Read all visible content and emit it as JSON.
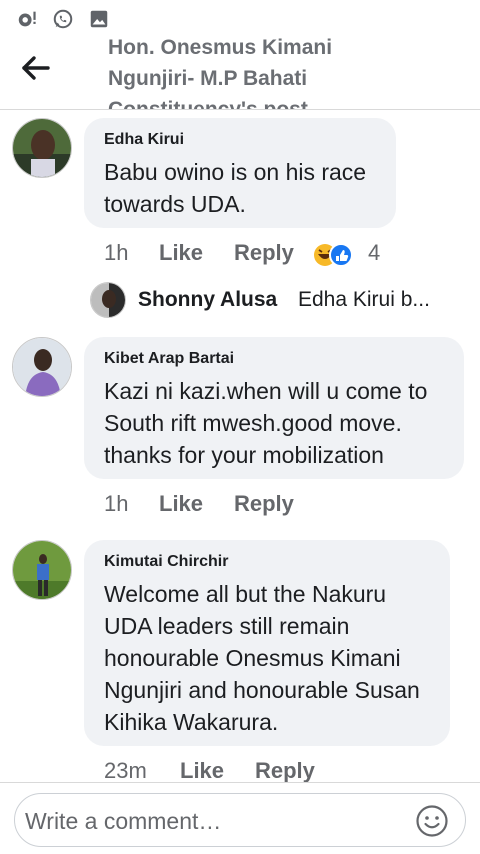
{
  "status_bar": {
    "icons": [
      "location-notification-icon",
      "whatsapp-icon",
      "gallery-icon"
    ]
  },
  "header": {
    "title_lines": [
      "Hon. Onesmus Kimani",
      "Ngunjiri- M.P Bahati",
      "Constituency's post"
    ],
    "back_icon": "arrow-left-icon"
  },
  "comments": [
    {
      "author": "Edha Kirui",
      "text_lines": [
        "Babu owino is on his race",
        "towards UDA."
      ],
      "time": "1h",
      "like_label": "Like",
      "reply_label": "Reply",
      "reaction_count": "4",
      "reply_preview": {
        "name": "Shonny Alusa",
        "snippet": "Edha Kirui b..."
      }
    },
    {
      "author": "Kibet Arap Bartai",
      "text_lines": [
        "Kazi ni kazi.when will u come to",
        "South rift mwesh.good move.",
        "thanks for your mobilization"
      ],
      "time": "1h",
      "like_label": "Like",
      "reply_label": "Reply"
    },
    {
      "author": "Kimutai Chirchir",
      "text_lines": [
        "Welcome all but the Nakuru",
        "UDA leaders still remain",
        "honourable Onesmus Kimani",
        "Ngunjiri and honourable Susan",
        "Kihika Wakarura."
      ],
      "time": "23m",
      "like_label": "Like",
      "reply_label": "Reply"
    }
  ],
  "compose": {
    "placeholder": "Write a comment…",
    "emoji_icon": "smiley-icon"
  },
  "colors": {
    "bubble": "#f0f2f5",
    "secondary_text": "#65676b",
    "whatsapp_green": "#25d366"
  }
}
